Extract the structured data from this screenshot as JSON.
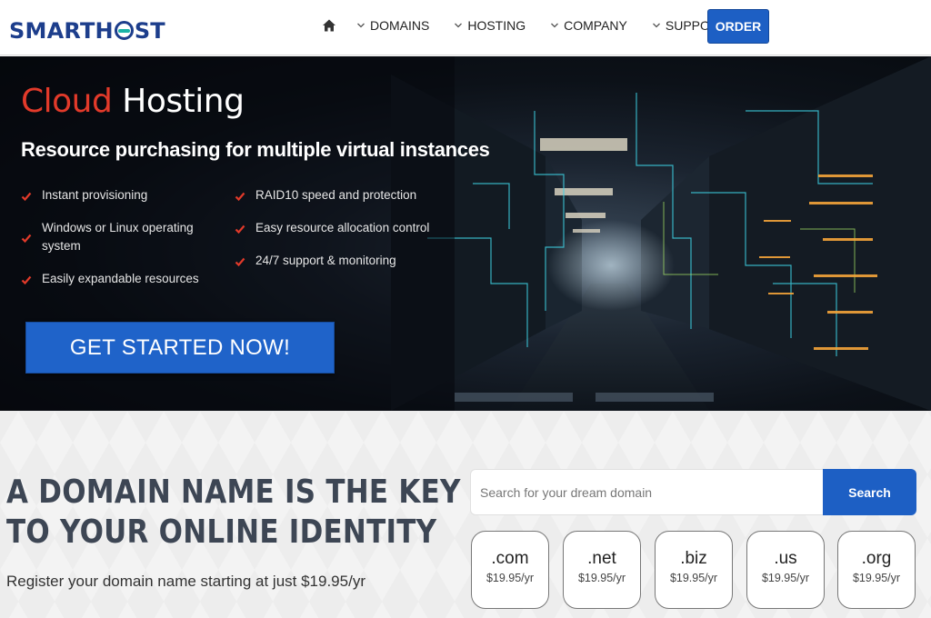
{
  "header": {
    "logo": {
      "part1": "SMARTH",
      "part2": "ST"
    },
    "nav": [
      {
        "label": "DOMAINS"
      },
      {
        "label": "HOSTING"
      },
      {
        "label": "COMPANY"
      },
      {
        "label": "SUPPORT"
      }
    ],
    "order_label": "ORDER",
    "icons": {
      "home": "home-icon",
      "dropdown": "chevron-down-icon"
    }
  },
  "hero": {
    "title_accent": "Cloud",
    "title_rest": "Hosting",
    "subtitle": "Resource purchasing for multiple virtual instances",
    "features_left": [
      "Instant provisioning",
      "Windows or Linux operating system",
      "Easily expandable resources"
    ],
    "features_right": [
      "RAID10 speed and protection",
      "Easy resource allocation control",
      "24/7 support & monitoring"
    ],
    "cta_label": "GET STARTED NOW!",
    "colors": {
      "accent": "#e23a2a",
      "check": "#e23a2a",
      "button": "#1f63c9"
    }
  },
  "domain": {
    "headline_line1": "A DOMAIN NAME IS THE KEY",
    "headline_line2": "TO YOUR ONLINE IDENTITY",
    "text": "Register your domain name starting at just $19.95/yr",
    "search": {
      "placeholder": "Search for your dream domain",
      "button": "Search"
    },
    "tlds": [
      {
        "ext": ".com",
        "price": "$19.95/yr"
      },
      {
        "ext": ".net",
        "price": "$19.95/yr"
      },
      {
        "ext": ".biz",
        "price": "$19.95/yr"
      },
      {
        "ext": ".us",
        "price": "$19.95/yr"
      },
      {
        "ext": ".org",
        "price": "$19.95/yr"
      }
    ]
  }
}
